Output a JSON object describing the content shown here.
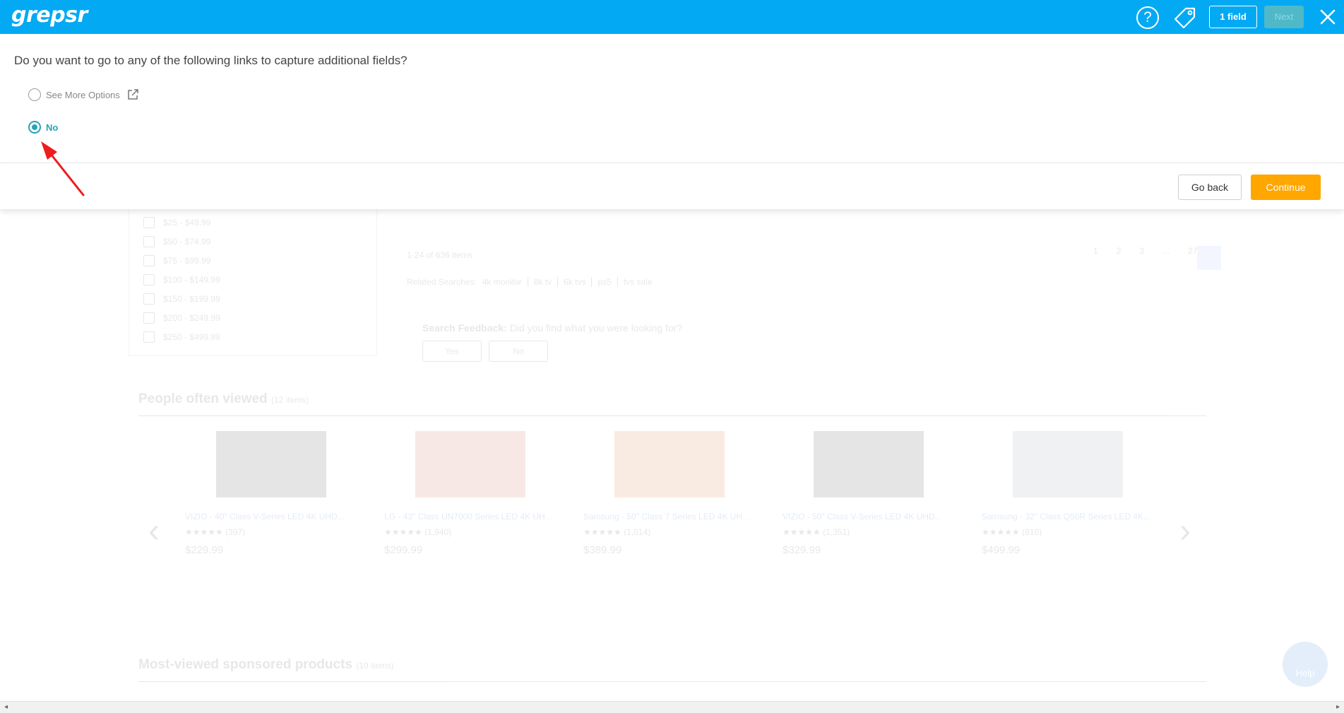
{
  "app": {
    "logo": "grepsr",
    "help_label": "?",
    "fields_label": "1 field",
    "next_label": "Next"
  },
  "colors": {
    "topbar": "#04a9f4",
    "accent": "#26a3b5",
    "continue": "#ffa600",
    "annotation_arrow": "#ee1c1c"
  },
  "dialog": {
    "question": "Do you want to go to any of the following links to capture additional fields?",
    "options": [
      {
        "label": "See More Options",
        "selected": false,
        "icon": "external-link-icon"
      },
      {
        "label": "No",
        "selected": true
      }
    ],
    "go_back_label": "Go back",
    "continue_label": "Continue"
  },
  "background_page": {
    "price_filters": [
      "$25 - $49.99",
      "$50 - $74.99",
      "$75 - $99.99",
      "$100 - $149.99",
      "$150 - $199.99",
      "$200 - $249.99",
      "$250 - $499.99"
    ],
    "results_count": "1-24 of 636 items",
    "pages": [
      "1",
      "2",
      "3",
      "...",
      "27"
    ],
    "related_label": "Related Searches:",
    "related": [
      "4k monitor",
      "8k tv",
      "6k tvs",
      "ps5",
      "tvs sale"
    ],
    "feedback_label": "Search Feedback:",
    "feedback_question": "Did you find what you were looking for?",
    "feedback_yes": "Yes",
    "feedback_no": "No",
    "people_viewed_title": "People often viewed",
    "people_viewed_count": "(12 items)",
    "products": [
      {
        "name": "VIZIO - 40\" Class V-Series LED 4K UHD...",
        "reviews": "(397)",
        "price": "$229.99"
      },
      {
        "name": "LG - 43\" Class UN7000 Series LED 4K UHD...",
        "reviews": "(1,940)",
        "price": "$299.99"
      },
      {
        "name": "Samsung - 50\" Class 7 Series LED 4K UHD...",
        "reviews": "(1,014)",
        "price": "$389.99"
      },
      {
        "name": "VIZIO - 50\" Class V-Series LED 4K UHD...",
        "reviews": "(1,351)",
        "price": "$329.99"
      },
      {
        "name": "Samsung - 32\" Class Q50R Series LED 4K...",
        "reviews": "(810)",
        "price": "$499.99"
      }
    ],
    "sponsored_title": "Most-viewed sponsored products",
    "sponsored_count": "(10 items)",
    "help_bubble": "Help"
  }
}
